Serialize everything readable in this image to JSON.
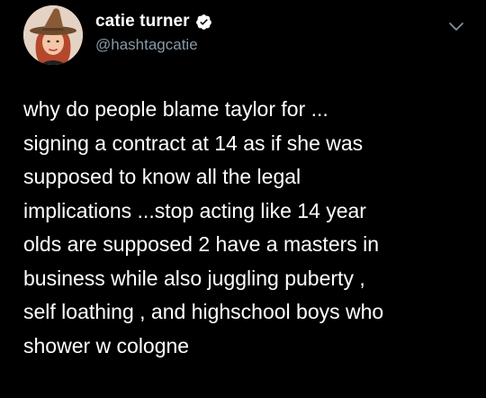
{
  "tweet": {
    "display_name": "catie turner",
    "handle": "@hashtagcatie",
    "verified": true,
    "text": "why do people blame taylor for ...\nsigning a contract at 14 as if she was\nsupposed to know all the legal\nimplications ...stop acting like 14 year\nolds are supposed 2 have a masters in\nbusiness while also juggling puberty ,\nself loathing , and highschool boys who\nshower w cologne"
  },
  "icons": {
    "avatar": "avatar",
    "verified": "verified-badge-icon",
    "more": "chevron-down-icon"
  },
  "colors": {
    "background": "#000000",
    "text": "#ffffff",
    "handle": "#8899a6",
    "verified": "#1da1f2"
  }
}
